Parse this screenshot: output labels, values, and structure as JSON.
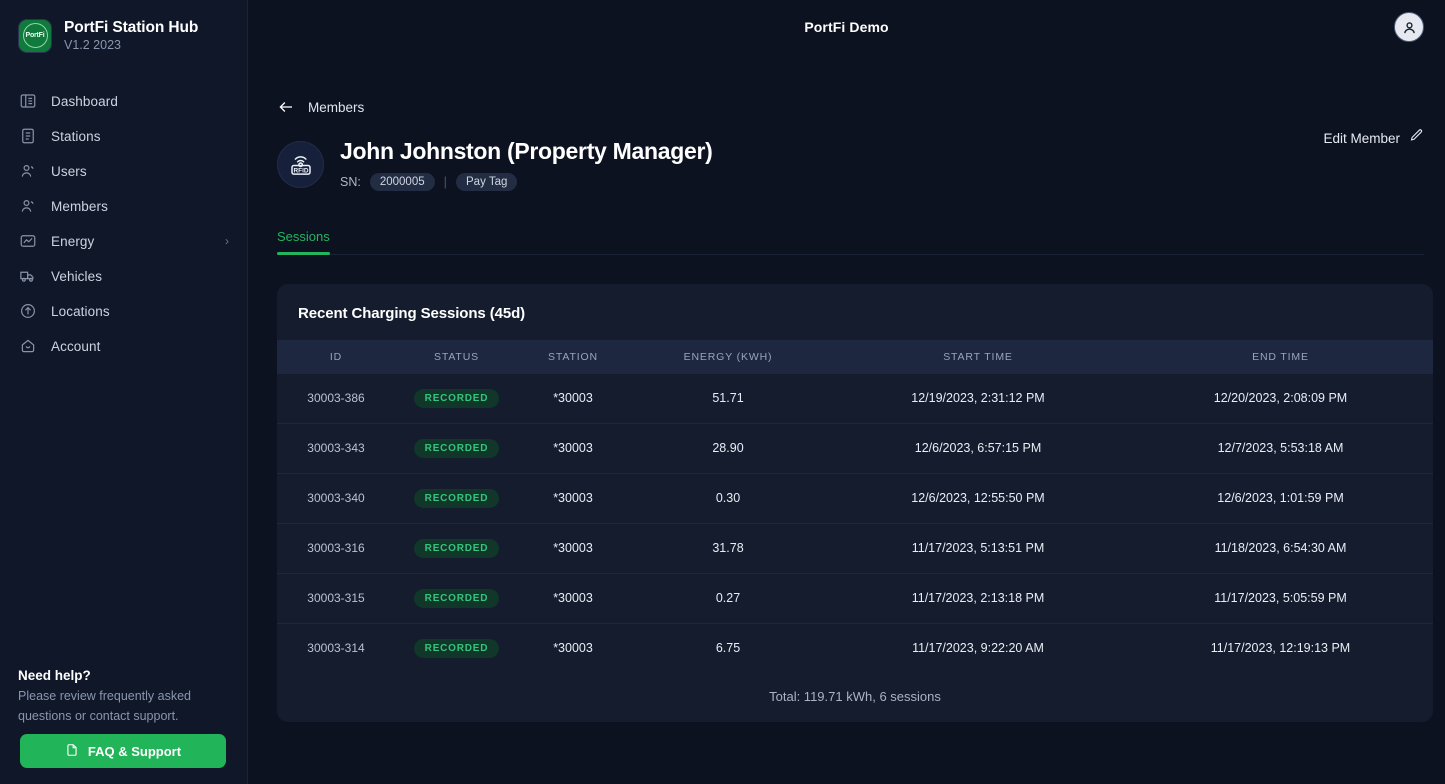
{
  "sidebar": {
    "brand": {
      "name": "PortFi Station Hub",
      "version": "V1.2 2023",
      "logo_text": "PortFi",
      "logo_color": "#0f7a3c"
    },
    "items": [
      {
        "label": "Dashboard",
        "icon": "dashboard-icon"
      },
      {
        "label": "Stations",
        "icon": "stations-icon"
      },
      {
        "label": "Users",
        "icon": "users-icon"
      },
      {
        "label": "Members",
        "icon": "members-icon"
      },
      {
        "label": "Energy",
        "icon": "energy-icon",
        "chevron": "›"
      },
      {
        "label": "Vehicles",
        "icon": "vehicles-icon"
      },
      {
        "label": "Locations",
        "icon": "locations-icon"
      },
      {
        "label": "Account",
        "icon": "account-icon"
      }
    ],
    "help": {
      "title": "Need help?",
      "body": "Please review frequently asked questions or contact support.",
      "button_label": "FAQ & Support",
      "button_color": "#22b459"
    }
  },
  "topbar": {
    "app_title": "PortFi Demo",
    "avatar": "user-avatar"
  },
  "breadcrumb": {
    "back_label": "Members",
    "arrow": "←"
  },
  "member": {
    "avatar_text": "RFID",
    "name": "John Johnston (Property Manager)",
    "sn_label": "SN:",
    "sn_value": "2000005",
    "separator": "|",
    "tag": "Pay Tag",
    "edit_label": "Edit Member",
    "edit_icon": "pencil-icon"
  },
  "tabs": [
    {
      "label": "Sessions",
      "active": true
    }
  ],
  "accent_color": "#22b45f",
  "sessions_card": {
    "title": "Recent Charging Sessions (45d)",
    "columns": [
      "ID",
      "STATUS",
      "STATION",
      "ENERGY (KWH)",
      "START TIME",
      "END TIME"
    ],
    "rows": [
      {
        "id": "30003-386",
        "status": "RECORDED",
        "station": "*30003",
        "energy": "51.71",
        "start": "12/19/2023, 2:31:12 PM",
        "end": "12/20/2023, 2:08:09 PM"
      },
      {
        "id": "30003-343",
        "status": "RECORDED",
        "station": "*30003",
        "energy": "28.90",
        "start": "12/6/2023, 6:57:15 PM",
        "end": "12/7/2023, 5:53:18 AM"
      },
      {
        "id": "30003-340",
        "status": "RECORDED",
        "station": "*30003",
        "energy": "0.30",
        "start": "12/6/2023, 12:55:50 PM",
        "end": "12/6/2023, 1:01:59 PM"
      },
      {
        "id": "30003-316",
        "status": "RECORDED",
        "station": "*30003",
        "energy": "31.78",
        "start": "11/17/2023, 5:13:51 PM",
        "end": "11/18/2023, 6:54:30 AM"
      },
      {
        "id": "30003-315",
        "status": "RECORDED",
        "station": "*30003",
        "energy": "0.27",
        "start": "11/17/2023, 2:13:18 PM",
        "end": "11/17/2023, 5:05:59 PM"
      },
      {
        "id": "30003-314",
        "status": "RECORDED",
        "station": "*30003",
        "energy": "6.75",
        "start": "11/17/2023, 9:22:20 AM",
        "end": "11/17/2023, 12:19:13 PM"
      }
    ],
    "footer": "Total: 119.71 kWh, 6 sessions"
  }
}
